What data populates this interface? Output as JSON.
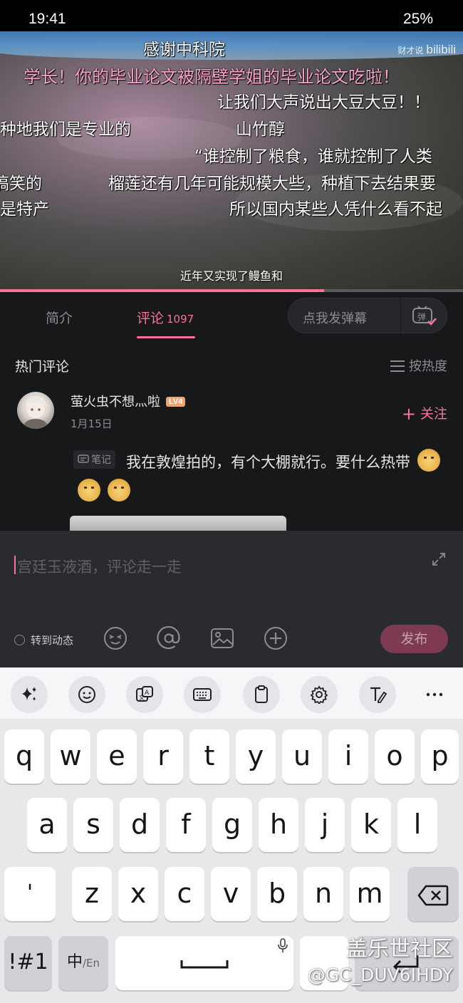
{
  "status_bar": {
    "time": "19:41",
    "battery": "25%"
  },
  "video": {
    "watermark_small": "财才说",
    "watermark_logo": "bilibili",
    "danmu": [
      "感谢中科院",
      "学长！你的毕业论文被隔壁学姐的毕业论文吃啦！",
      "让我们大声说出大豆大豆！！",
      "种地我们是专业的",
      "山竹醇",
      "“谁控制了粮食，谁就控制了人类",
      "搞笑的",
      "榴莲还有几年可能规模大些，种植下去结果要",
      "是特产",
      "所以国内某些人凭什么看不起"
    ],
    "subtitle": "近年又实现了鳗鱼和",
    "progress": 0.7
  },
  "tabs": {
    "intro": "简介",
    "comments": "评论",
    "comments_count": "1097",
    "danmu_placeholder": "点我发弹幕",
    "danmu_button": "弹"
  },
  "comments": {
    "section_title": "热门评论",
    "sort_label": "按热度",
    "items": [
      {
        "username": "萤火虫不想灬啦",
        "level": "LV4",
        "date": "1月15日",
        "follow": "关注",
        "note_tag": "笔记",
        "text": "我在敦煌拍的，有个大棚就行。要什么热带"
      }
    ]
  },
  "reply": {
    "placeholder": "宫廷玉液酒，评论走一走",
    "forward_label": "转到动态",
    "publish": "发布",
    "tools": [
      "emoji-icon",
      "at-icon",
      "image-icon",
      "plus-icon"
    ]
  },
  "keyboard": {
    "toolbar": [
      "sparkle-icon",
      "smiley-icon",
      "translate-icon",
      "keyboard-icon",
      "clipboard-icon",
      "settings-icon",
      "handwriting-icon",
      "more-icon"
    ],
    "row1": [
      "q",
      "w",
      "e",
      "r",
      "t",
      "y",
      "u",
      "i",
      "o",
      "p"
    ],
    "row2": [
      "a",
      "s",
      "d",
      "f",
      "g",
      "h",
      "j",
      "k",
      "l"
    ],
    "row3": [
      "'",
      "z",
      "x",
      "c",
      "v",
      "b",
      "n",
      "m"
    ],
    "sym": "!#1",
    "lang_main": "中",
    "lang_sub": "/En"
  },
  "overlay": {
    "forum": "盖乐世社区",
    "user": "@GC_DUV6IHDY"
  }
}
